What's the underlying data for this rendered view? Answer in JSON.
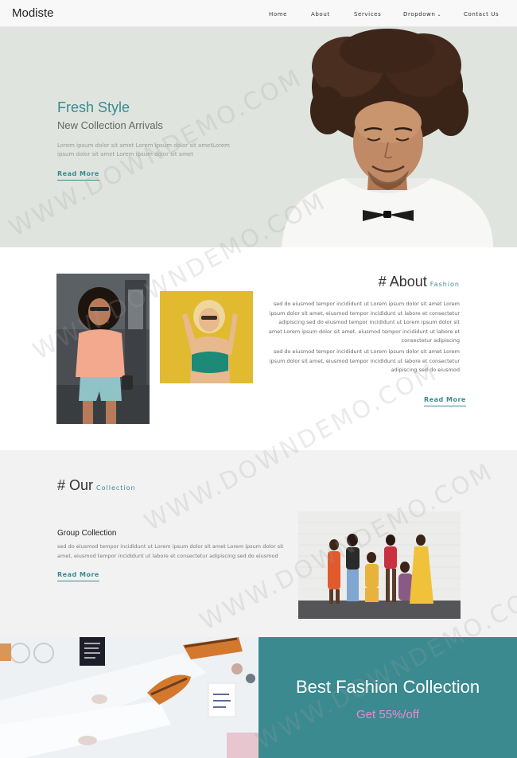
{
  "nav": {
    "brand": "Modiste",
    "items": [
      {
        "label": "Home"
      },
      {
        "label": "About"
      },
      {
        "label": "Services"
      },
      {
        "label": "Dropdown"
      },
      {
        "label": "Contact Us"
      }
    ]
  },
  "hero": {
    "title": "Fresh Style",
    "subtitle": "New Collection Arrivals",
    "text": "Lorem ipsum dolor sit amet Lorem ipsum dolor sit ametLorem ipsum dolor sit amet Lorem ipsum dolor sit amet",
    "read_more": "Read More"
  },
  "about": {
    "heading": "# About",
    "accent": "Fashion",
    "paragraph1": "sed do eiusmod tempor incididunt ut Lorem ipsum dolor sit amet Lorem ipsum dolor sit amet, eiusmod tempor incididunt ut labore et consectetur adipiscing sed do eiusmod tempor incididunt ut Lorem ipsum dolor sit amet Lorem ipsum dolor sit amet, eiusmod tempor incididunt ut labore et consectetur adipiscing",
    "paragraph2": "sed do eiusmod tempor incididunt ut Lorem ipsum dolor sit amet Lorem ipsum dolor sit amet, eiusmod tempor incididunt ut labore et consectetur adipiscing sed do eiusmod",
    "read_more": "Read More"
  },
  "collection": {
    "heading": "# Our",
    "accent": "Collection",
    "group_title": "Group Collection",
    "group_text": "sed do eiusmod tempor incididunt ut Lorem ipsum dolor sit amet Lorem ipsum dolor sit amet, eiusmod tempor incididunt ut labore et consectetur adipiscing sed do eiusmod",
    "read_more": "Read More"
  },
  "banner": {
    "title": "Best Fashion Collection",
    "offer": "Get 55%/off"
  },
  "watermark": "WWW.DOWNDEMO.COM",
  "colors": {
    "accent": "#3a8a8f",
    "hero_bg": "#dfe4df",
    "offer": "#e98ad6"
  }
}
